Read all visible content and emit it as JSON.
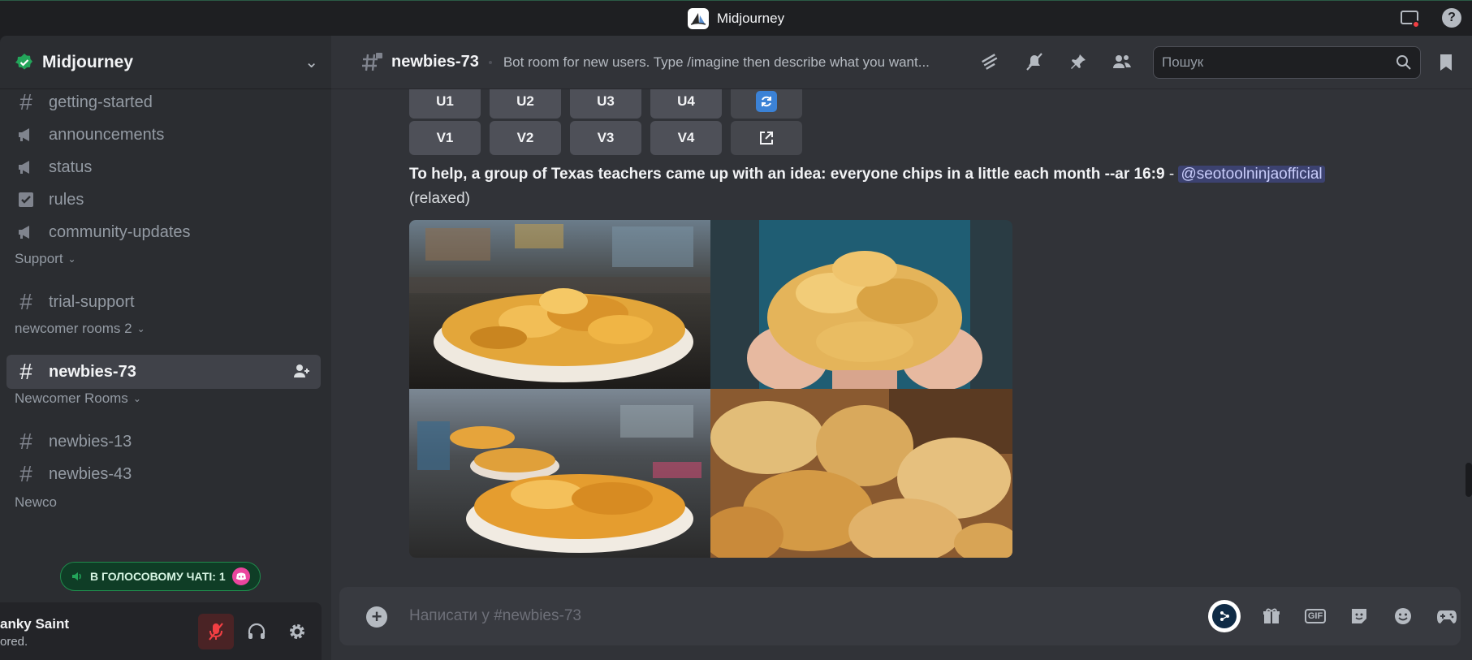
{
  "titlebar": {
    "app_title": "Midjourney"
  },
  "server": {
    "name": "Midjourney"
  },
  "sidebar": {
    "channels_top": [
      {
        "name": "getting-started",
        "icon": "hash-icon"
      },
      {
        "name": "announcements",
        "icon": "megaphone-icon"
      },
      {
        "name": "status",
        "icon": "megaphone-icon"
      },
      {
        "name": "rules",
        "icon": "checkbox-icon"
      },
      {
        "name": "community-updates",
        "icon": "megaphone-icon"
      }
    ],
    "cat_support": "Support",
    "trial_support": "trial-support",
    "cat_newcomer2": "newcomer rooms 2",
    "active_channel": "newbies-73",
    "cat_newcomer": "Newcomer Rooms",
    "newbies_13": "newbies-13",
    "newbies_43": "newbies-43",
    "cat_partial": "Newco",
    "voice_pill": "В ГОЛОСОВОМУ ЧАТІ: 1"
  },
  "user": {
    "name": "anky Saint",
    "status": "ored."
  },
  "channel": {
    "name": "newbies-73",
    "topic": "Bot room for new users. Type /imagine then describe what you want..."
  },
  "search": {
    "placeholder": "Пошук"
  },
  "message": {
    "upscale_buttons": [
      "U1",
      "U2",
      "U3",
      "U4"
    ],
    "variation_buttons": [
      "V1",
      "V2",
      "V3",
      "V4"
    ],
    "prompt_text": "To help, a group of Texas teachers came up with an idea: everyone chips in a little each month --ar 16:9",
    "dash": " - ",
    "mention": "@seotoolninjaofficial",
    "mode": "(relaxed)"
  },
  "composer": {
    "placeholder": "Написати у #newbies-73"
  },
  "colors": {
    "accent": "#5865f2",
    "mention_bg": "#3c4270",
    "voice_green": "#1f8b4c"
  }
}
